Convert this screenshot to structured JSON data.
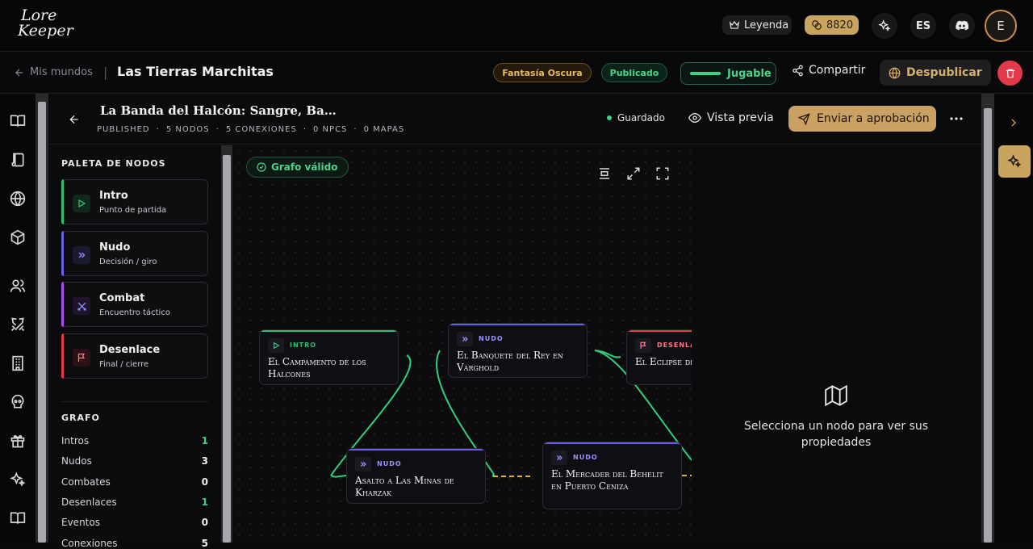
{
  "app": {
    "logo_line1": "Lore",
    "logo_line2": "Keeper"
  },
  "header": {
    "legend_label": "Leyenda",
    "coins": "8820",
    "language": "ES",
    "avatar_initial": "E"
  },
  "world": {
    "back_label": "Mis mundos",
    "title": "Las Tierras Marchitas",
    "genre_tag": "Fantasía Oscura",
    "status_tag": "Publicado",
    "playable_label": "Jugable",
    "share_label": "Compartir",
    "unpublish_label": "Despublicar"
  },
  "editor": {
    "title": "La Banda del Halcón: Sangre, Ba…",
    "meta": [
      "PUBLISHED",
      "5 NODOS",
      "5 CONEXIONES",
      "0 NPCS",
      "0 MAPAS"
    ],
    "saved_label": "Guardado",
    "preview_label": "Vista previa",
    "submit_label": "Enviar a aprobación"
  },
  "palette": {
    "heading": "PALETA DE NODOS",
    "items": [
      {
        "title": "Intro",
        "subtitle": "Punto de partida",
        "color": "#2fbf74",
        "icon": "play-icon"
      },
      {
        "title": "Nudo",
        "subtitle": "Decisión / giro",
        "color": "#6a5ee8",
        "icon": "chevrons-right-icon"
      },
      {
        "title": "Combat",
        "subtitle": "Encuentro táctico",
        "color": "#a64ee8",
        "icon": "swords-icon"
      },
      {
        "title": "Desenlace",
        "subtitle": "Final / cierre",
        "color": "#e23a4a",
        "icon": "flag-icon"
      }
    ]
  },
  "graph_stats": {
    "heading": "GRAFO",
    "rows": [
      {
        "label": "Intros",
        "value": "1",
        "highlight": true
      },
      {
        "label": "Nudos",
        "value": "3",
        "highlight": false
      },
      {
        "label": "Combates",
        "value": "0",
        "highlight": false
      },
      {
        "label": "Desenlaces",
        "value": "1",
        "highlight": true
      },
      {
        "label": "Eventos",
        "value": "0",
        "highlight": false
      },
      {
        "label": "Conexiones",
        "value": "5",
        "highlight": false
      }
    ]
  },
  "canvas": {
    "valid_label": "Grafo válido",
    "nodes": [
      {
        "kind": "INTRO",
        "name": "El Campamento de los Halcones",
        "color": "#2fbf74"
      },
      {
        "kind": "NUDO",
        "name": "El Banquete del Rey en Varghold",
        "color": "#6a5ee8"
      },
      {
        "kind": "DESENLACE",
        "name": "El Eclipse de la Frontera",
        "color": "#e23a4a"
      },
      {
        "kind": "NUDO",
        "name": "Asalto a Las Minas de Kharzak",
        "color": "#6a5ee8"
      },
      {
        "kind": "NUDO",
        "name": "El Mercader del Behelit en Puerto Ceniza",
        "color": "#6a5ee8"
      }
    ]
  },
  "properties": {
    "empty_message": "Selecciona un nodo para ver sus propiedades"
  },
  "colors": {
    "accent_gold": "#caa163",
    "success": "#3ad584",
    "danger": "#e23a4a"
  }
}
